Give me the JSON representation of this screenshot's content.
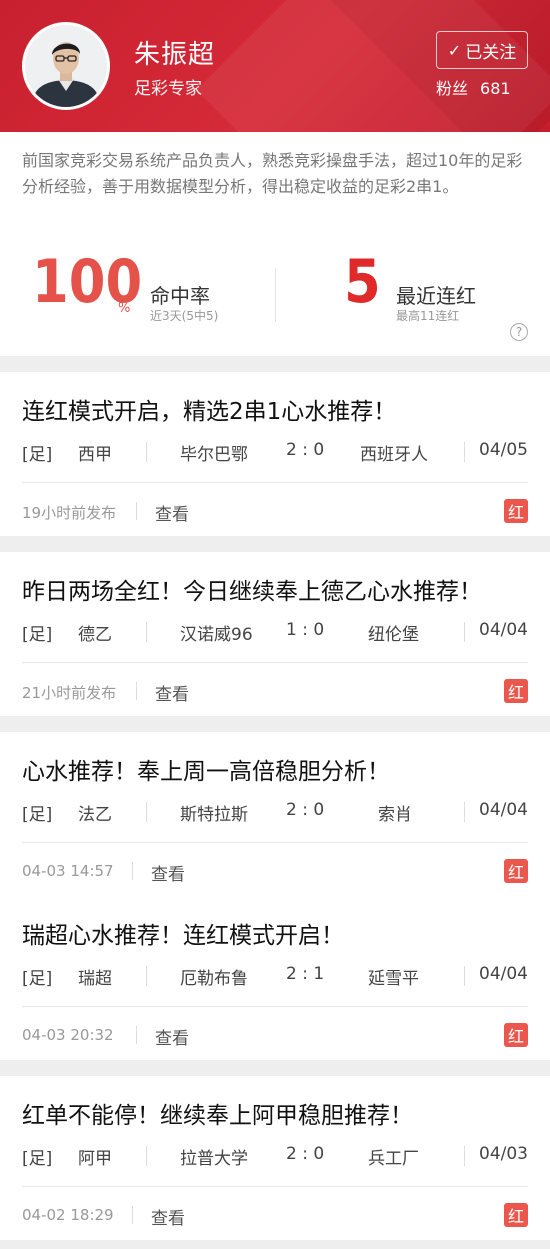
{
  "expert": {
    "name": "朱振超",
    "title": "足彩专家",
    "follow_label": "已关注",
    "fans_label": "粉丝",
    "fans_count": "681",
    "bio": "前国家竞彩交易系统产品负责人，熟悉竞彩操盘手法，超过10年的足彩分析经验，善于用数据模型分析，得出稳定收益的足彩2串1。"
  },
  "stats": {
    "hit_rate": {
      "value": "100",
      "unit": "%",
      "label": "命中率",
      "sub": "近3天(5中5)"
    },
    "streak": {
      "value": "5",
      "label": "最近连红",
      "sub": "最高11连红"
    }
  },
  "colors": {
    "brand_red": "#d62a38",
    "accent_red": "#e4524a"
  },
  "icons": {
    "follow": "check-icon",
    "help": "question-icon"
  },
  "posts": [
    {
      "title": "连红模式开启，精选2串1心水推荐！",
      "tag": "[足]",
      "league": "西甲",
      "home": "毕尔巴鄂",
      "score": "2 : 0",
      "away": "西班牙人",
      "date": "04/05",
      "time": "19小时前发布",
      "view": "查看",
      "badge": "红"
    },
    {
      "title": "昨日两场全红！今日继续奉上德乙心水推荐！",
      "tag": "[足]",
      "league": "德乙",
      "home": "汉诺威96",
      "score": "1 : 0",
      "away": "纽伦堡",
      "date": "04/04",
      "time": "21小时前发布",
      "view": "查看",
      "badge": "红"
    },
    {
      "title": "心水推荐！奉上周一高倍稳胆分析！",
      "tag": "[足]",
      "league": "法乙",
      "home": "斯特拉斯",
      "score": "2 : 0",
      "away": "索肖",
      "date": "04/04",
      "time": "04-03 14:57",
      "view": "查看",
      "badge": "红"
    },
    {
      "title": "瑞超心水推荐！连红模式开启！",
      "tag": "[足]",
      "league": "瑞超",
      "home": "厄勒布鲁",
      "score": "2 : 1",
      "away": "延雪平",
      "date": "04/04",
      "time": "04-03 20:32",
      "view": "查看",
      "badge": "红"
    },
    {
      "title": "红单不能停！继续奉上阿甲稳胆推荐！",
      "tag": "[足]",
      "league": "阿甲",
      "home": "拉普大学",
      "score": "2 : 0",
      "away": "兵工厂",
      "date": "04/03",
      "time": "04-02 18:29",
      "view": "查看",
      "badge": "红"
    }
  ]
}
